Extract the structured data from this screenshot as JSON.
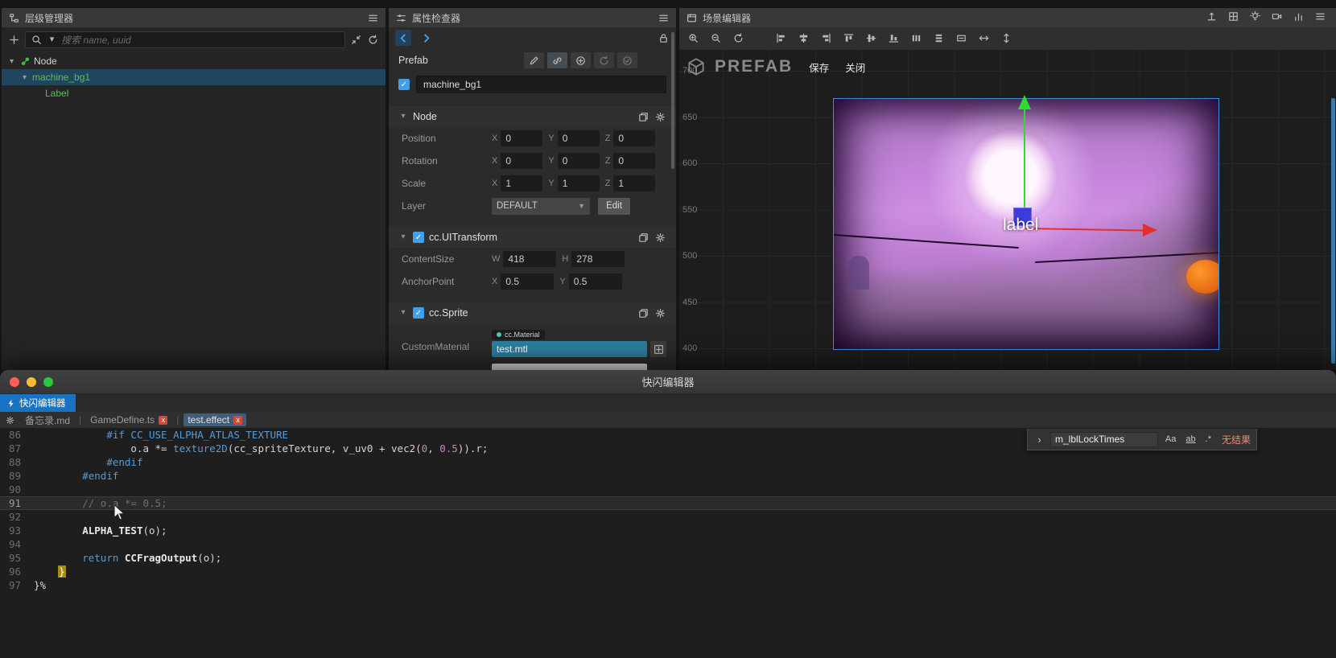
{
  "colors": {
    "accent_blue": "#3fa0e8",
    "prefab_green": "#5dbd5d",
    "selection_teal": "#2a7fa0",
    "error_red": "#d44a3a",
    "find_no_result_red": "#f48771"
  },
  "hierarchy": {
    "title": "层级管理器",
    "search_placeholder": "搜索 name, uuid",
    "tree": [
      {
        "label": "Node",
        "level": 0,
        "icon": "node-icon",
        "expanded": true,
        "selected": false,
        "green": false
      },
      {
        "label": "machine_bg1",
        "level": 1,
        "icon": null,
        "expanded": true,
        "selected": true,
        "green": true
      },
      {
        "label": "Label",
        "level": 2,
        "icon": null,
        "expanded": false,
        "selected": false,
        "green": true
      }
    ]
  },
  "inspector": {
    "title": "属性检查器",
    "prefab": {
      "label": "Prefab",
      "buttons": [
        "edit-prefab-icon",
        "unlink-prefab-icon",
        "add-prefab-icon",
        "revert-prefab-icon",
        "apply-prefab-icon"
      ]
    },
    "node_active": true,
    "node_name": "machine_bg1",
    "node_section": {
      "title": "Node",
      "vectors": [
        {
          "label": "Position",
          "fields": [
            {
              "axis": "X",
              "value": "0"
            },
            {
              "axis": "Y",
              "value": "0"
            },
            {
              "axis": "Z",
              "value": "0"
            }
          ]
        },
        {
          "label": "Rotation",
          "fields": [
            {
              "axis": "X",
              "value": "0"
            },
            {
              "axis": "Y",
              "value": "0"
            },
            {
              "axis": "Z",
              "value": "0"
            }
          ]
        },
        {
          "label": "Scale",
          "fields": [
            {
              "axis": "X",
              "value": "1"
            },
            {
              "axis": "Y",
              "value": "1"
            },
            {
              "axis": "Z",
              "value": "1"
            }
          ]
        }
      ],
      "layer": {
        "label": "Layer",
        "value": "DEFAULT",
        "edit_button": "Edit"
      }
    },
    "uitransform_section": {
      "title": "cc.UITransform",
      "enabled": true,
      "rows": [
        {
          "label": "ContentSize",
          "fields": [
            {
              "axis": "W",
              "value": "418"
            },
            {
              "axis": "H",
              "value": "278"
            }
          ]
        },
        {
          "label": "AnchorPoint",
          "fields": [
            {
              "axis": "X",
              "value": "0.5"
            },
            {
              "axis": "Y",
              "value": "0.5"
            }
          ]
        }
      ]
    },
    "sprite_section": {
      "title": "cc.Sprite",
      "enabled": true,
      "custom_material": {
        "label": "CustomMaterial",
        "type_tag": "cc.Material",
        "value": "test.mtl"
      }
    }
  },
  "scene": {
    "title": "场景编辑器",
    "header_icons": [
      "gizmo-icon",
      "grid-icon",
      "light-icon",
      "camera-icon",
      "stats-icon",
      "scene-menu-icon"
    ],
    "toolbar": {
      "view_icons": [
        "zoom-in-icon",
        "zoom-out-icon",
        "reset-view-icon"
      ],
      "align_icons": [
        "align-left-icon",
        "align-center-h-icon",
        "align-right-icon",
        "align-top-icon",
        "align-middle-icon",
        "align-bottom-icon",
        "distribute-h-icon",
        "distribute-v-icon",
        "same-size-icon",
        "stretch-h-icon",
        "stretch-v-icon"
      ]
    },
    "prefab_bar": {
      "watermark": "PREFAB",
      "save_button": "保存",
      "close_button": "关闭"
    },
    "ruler_marks": [
      "700",
      "650",
      "600",
      "550",
      "500",
      "450",
      "400"
    ],
    "selection_label": "label"
  },
  "editor_window": {
    "window_title": "快闪编辑器",
    "app_tab_label": "快闪编辑器",
    "close_glyph": "x",
    "file_tabs": [
      {
        "label": "备忘录.md",
        "closable": false,
        "active": false
      },
      {
        "label": "GameDefine.ts",
        "closable": true,
        "active": false
      },
      {
        "label": "test.effect",
        "closable": true,
        "active": true
      }
    ],
    "search": {
      "query": "m_lblLockTimes",
      "case_toggle": "Aa",
      "word_toggle": "ab",
      "regex_toggle": ".*",
      "results": "无结果"
    },
    "code": {
      "lines": [
        {
          "num": 86,
          "segments": [
            {
              "t": "            ",
              "c": "txt"
            },
            {
              "t": "#if CC_USE_ALPHA_ATLAS_TEXTURE",
              "c": "kw"
            }
          ]
        },
        {
          "num": 87,
          "segments": [
            {
              "t": "                o.a *= ",
              "c": "txt"
            },
            {
              "t": "texture2D",
              "c": "kw"
            },
            {
              "t": "(cc_spriteTexture, v_uv0 + vec2(",
              "c": "txt"
            },
            {
              "t": "0",
              "c": "num"
            },
            {
              "t": ", ",
              "c": "txt"
            },
            {
              "t": "0.5",
              "c": "num"
            },
            {
              "t": ")).r;",
              "c": "txt"
            }
          ]
        },
        {
          "num": 88,
          "segments": [
            {
              "t": "            ",
              "c": "txt"
            },
            {
              "t": "#endif",
              "c": "kw"
            }
          ]
        },
        {
          "num": 89,
          "segments": [
            {
              "t": "        ",
              "c": "txt"
            },
            {
              "t": "#endif",
              "c": "kw"
            }
          ]
        },
        {
          "num": 90,
          "segments": []
        },
        {
          "num": 91,
          "current": true,
          "segments": [
            {
              "t": "        ",
              "c": "txt"
            },
            {
              "t": "// o.a *= 0.5;",
              "c": "cmt"
            }
          ]
        },
        {
          "num": 92,
          "segments": []
        },
        {
          "num": 93,
          "segments": [
            {
              "t": "        ",
              "c": "txt"
            },
            {
              "t": "ALPHA_TEST",
              "c": "bold"
            },
            {
              "t": "(o);",
              "c": "txt"
            }
          ]
        },
        {
          "num": 94,
          "segments": []
        },
        {
          "num": 95,
          "segments": [
            {
              "t": "        ",
              "c": "txt"
            },
            {
              "t": "return ",
              "c": "kw"
            },
            {
              "t": "CCFragOutput",
              "c": "bold"
            },
            {
              "t": "(o);",
              "c": "txt"
            }
          ]
        },
        {
          "num": 96,
          "segments": [
            {
              "t": "    ",
              "c": "txt"
            },
            {
              "t": "}",
              "c": "match"
            }
          ]
        },
        {
          "num": 97,
          "segments": [
            {
              "t": "}%",
              "c": "txt"
            }
          ]
        }
      ]
    }
  }
}
